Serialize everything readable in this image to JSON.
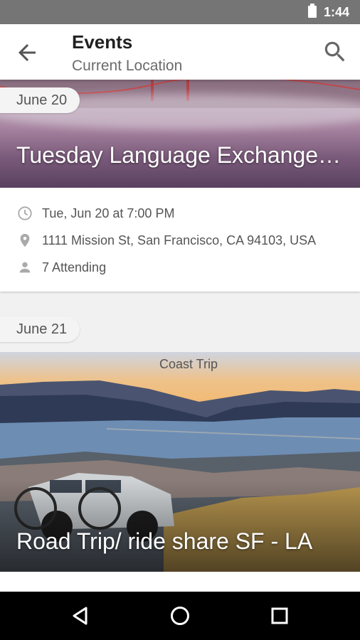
{
  "status_bar": {
    "time": "1:44",
    "battery_icon": "battery-full-icon"
  },
  "app_bar": {
    "title": "Events",
    "subtitle": "Current Location",
    "back_icon": "arrow-back-icon",
    "search_icon": "search-icon"
  },
  "events": [
    {
      "date_label": "June 20",
      "title": "Tuesday Language Exchange & Meet-Up",
      "datetime": "Tue, Jun 20 at 7:00 PM",
      "address": "1111 Mission St, San Francisco, CA 94103, USA",
      "attending": "7 Attending"
    },
    {
      "date_label": "June 21",
      "image_caption": "Coast Trip",
      "title": "Road Trip/ ride share SF - LA"
    }
  ],
  "nav_bar": {
    "back_icon": "nav-back-icon",
    "home_icon": "nav-home-icon",
    "recents_icon": "nav-recents-icon"
  }
}
